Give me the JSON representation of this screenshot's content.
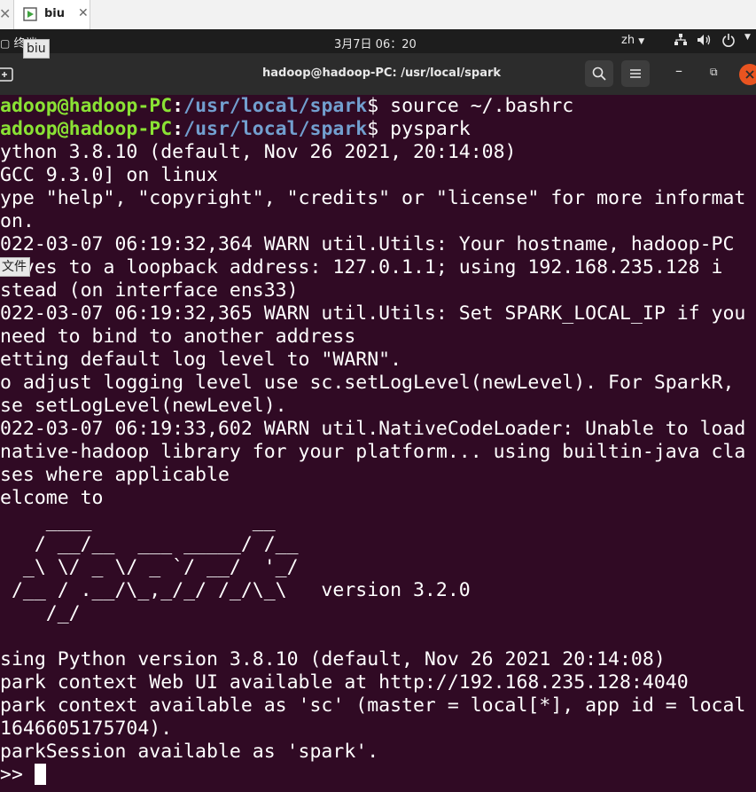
{
  "vm_tabs": {
    "active_tab_label": "biu"
  },
  "topbar": {
    "activities_label": "终端",
    "clock": "3月7日 06：20",
    "input_method": "zh",
    "tooltip_biu": "biu",
    "tooltip_file": "文件"
  },
  "terminal": {
    "window_title": "hadoop@hadoop-PC: /usr/local/spark",
    "prompt_user": "adoop@hadoop-PC",
    "prompt_path": "/usr/local/spark",
    "lines": [
      {
        "kind": "prompt",
        "command": " source ~/.bashrc"
      },
      {
        "kind": "prompt",
        "command": " pyspark"
      },
      {
        "kind": "text",
        "text": "ython 3.8.10 (default, Nov 26 2021, 20:14:08)"
      },
      {
        "kind": "text",
        "text": "GCC 9.3.0] on linux"
      },
      {
        "kind": "text",
        "text": "ype \"help\", \"copyright\", \"credits\" or \"license\" for more informat"
      },
      {
        "kind": "text",
        "text": "on."
      },
      {
        "kind": "text",
        "text": "022-03-07 06:19:32,364 WARN util.Utils: Your hostname, hadoop-PC"
      },
      {
        "kind": "text",
        "text": "olves to a loopback address: 127.0.1.1; using 192.168.235.128 i"
      },
      {
        "kind": "text",
        "text": "stead (on interface ens33)"
      },
      {
        "kind": "text",
        "text": "022-03-07 06:19:32,365 WARN util.Utils: Set SPARK_LOCAL_IP if you"
      },
      {
        "kind": "text",
        "text": "need to bind to another address"
      },
      {
        "kind": "text",
        "text": "etting default log level to \"WARN\"."
      },
      {
        "kind": "text",
        "text": "o adjust logging level use sc.setLogLevel(newLevel). For SparkR,"
      },
      {
        "kind": "text",
        "text": "se setLogLevel(newLevel)."
      },
      {
        "kind": "text",
        "text": "022-03-07 06:19:33,602 WARN util.NativeCodeLoader: Unable to load"
      },
      {
        "kind": "text",
        "text": "native-hadoop library for your platform... using builtin-java cla"
      },
      {
        "kind": "text",
        "text": "ses where applicable"
      },
      {
        "kind": "text",
        "text": "elcome to"
      },
      {
        "kind": "text",
        "text": "    ____              __"
      },
      {
        "kind": "text",
        "text": "   / __/__  ___ _____/ /__"
      },
      {
        "kind": "text",
        "text": "  _\\ \\/ _ \\/ _ `/ __/  '_/"
      },
      {
        "kind": "text",
        "text": " /__ / .__/\\_,_/_/ /_/\\_\\   version 3.2.0"
      },
      {
        "kind": "text",
        "text": "    /_/"
      },
      {
        "kind": "text",
        "text": ""
      },
      {
        "kind": "text",
        "text": "sing Python version 3.8.10 (default, Nov 26 2021 20:14:08)"
      },
      {
        "kind": "text",
        "text": "park context Web UI available at http://192.168.235.128:4040"
      },
      {
        "kind": "text",
        "text": "park context available as 'sc' (master = local[*], app id = local"
      },
      {
        "kind": "text",
        "text": "1646605175704)."
      },
      {
        "kind": "text",
        "text": "parkSession available as 'spark'."
      },
      {
        "kind": "repl",
        "text": ">> "
      }
    ]
  },
  "colors": {
    "terminal_bg": "#300a24",
    "prompt_user": "#8ae234",
    "prompt_path": "#729fcf",
    "close_button": "#e95420"
  },
  "icons": {
    "vm_tab": "vm-monitor-icon",
    "new_tab": "new-tab-icon",
    "search": "search-icon",
    "menu": "hamburger-menu-icon",
    "minimize": "minimize-icon",
    "restore": "restore-icon",
    "close": "close-icon",
    "network": "network-icon",
    "volume": "volume-icon",
    "power": "power-icon"
  }
}
